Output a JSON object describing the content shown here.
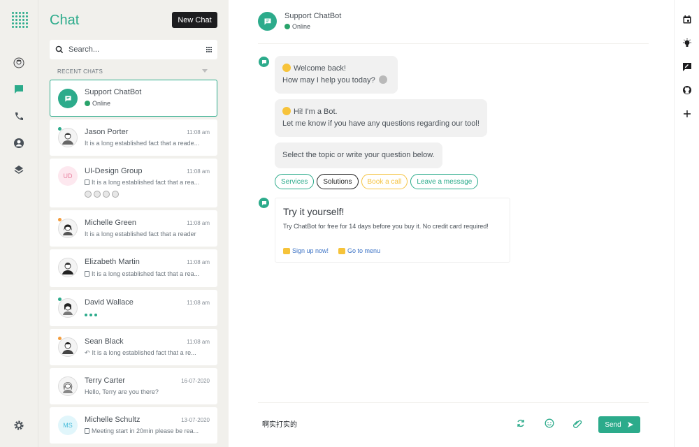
{
  "app": {
    "brand_color": "#2cab8b"
  },
  "rail": {
    "icons": [
      "logo-dots",
      "avatar-icon",
      "chat-icon",
      "phone-icon",
      "user-circle-icon",
      "layers-icon",
      "moon-icon",
      "gear-icon"
    ]
  },
  "list": {
    "title": "Chat",
    "new_chat_label": "New Chat",
    "search_placeholder": "Search...",
    "section_label": "RECENT CHATS",
    "items": [
      {
        "name": "Support ChatBot",
        "status": "Online"
      },
      {
        "name": "Jason Porter",
        "time": "11:08 am",
        "message": "It is a long established fact that a reade..."
      },
      {
        "name": "UI-Design Group",
        "time": "11:08 am",
        "message": "It is a long established fact that a rea...",
        "initials": "UD"
      },
      {
        "name": "Michelle Green",
        "time": "11:08 am",
        "message": "It is a long established fact that a reader"
      },
      {
        "name": "Elizabeth Martin",
        "time": "11:08 am",
        "message": "It is a long established fact that a rea..."
      },
      {
        "name": "David Wallace",
        "time": "11:08 am"
      },
      {
        "name": "Sean Black",
        "time": "11:08 am",
        "message": "It is a long established fact that a re..."
      },
      {
        "name": "Terry Carter",
        "time": "16-07-2020",
        "message": "Hello, Terry are you there?"
      },
      {
        "name": "Michelle Schultz",
        "time": "13-07-2020",
        "message": "Meeting start in 20min please be rea...",
        "initials": "MS"
      }
    ]
  },
  "main": {
    "header": {
      "name": "Support ChatBot",
      "status": "Online"
    },
    "messages": {
      "m1_line1": "Welcome back!",
      "m1_line2": "How may I help you today?",
      "m2_line1": "Hi! I'm a Bot.",
      "m2_line2": "Let me know if you have any questions regarding our tool!",
      "m3": "Select the topic or write your question below."
    },
    "chips": [
      "Services",
      "Solutions",
      "Book a call",
      "Leave a message"
    ],
    "card": {
      "title": "Try it yourself!",
      "desc": "Try ChatBot for free for 14 days before you buy it. No credit card required!",
      "link1": "Sign up now!",
      "link2": "Go to menu"
    },
    "composer": {
      "value": "啊实打实的",
      "send_label": "Send"
    }
  },
  "right_rail": {
    "icons": [
      "calendar-icon",
      "bulb-icon",
      "feedback-icon",
      "github-icon",
      "plus-icon"
    ]
  }
}
